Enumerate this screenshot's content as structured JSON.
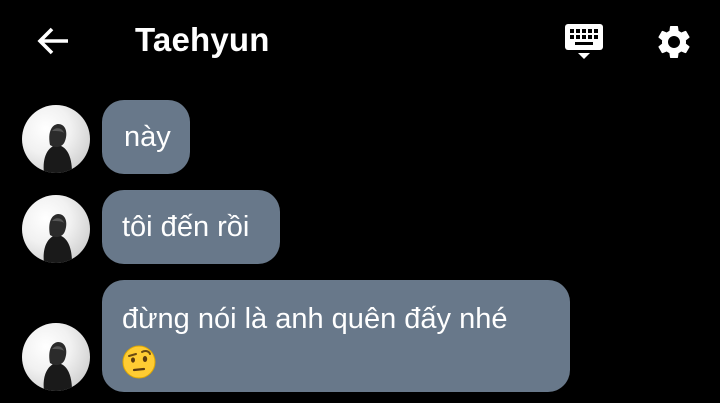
{
  "header": {
    "title": "Taehyun",
    "back_icon": "arrow-left-icon",
    "keyboard_icon": "keyboard-icon",
    "settings_icon": "gear-icon"
  },
  "messages": [
    {
      "text": "này"
    },
    {
      "text": "tôi đến rồi"
    },
    {
      "text": "đừng nói là anh quên đấy nhé",
      "emoji": "face-with-raised-eyebrow"
    }
  ],
  "colors": {
    "background": "#000000",
    "bubble": "#68788a",
    "text": "#ffffff"
  }
}
